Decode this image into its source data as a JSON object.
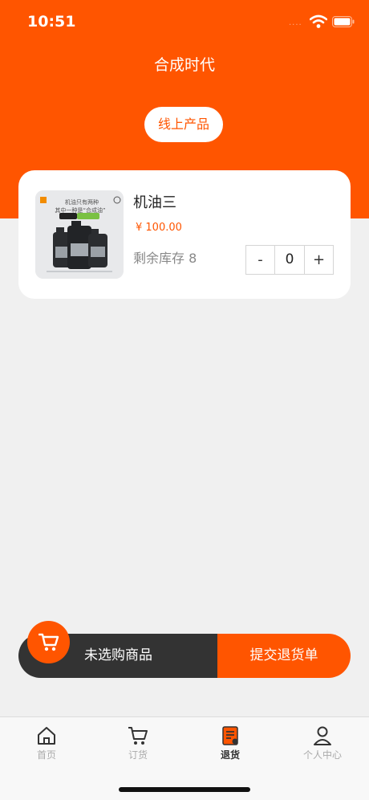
{
  "status_bar": {
    "time": "10:51",
    "signal_dots": "····"
  },
  "header": {
    "title": "合成时代",
    "segment_label": "线上产品"
  },
  "product": {
    "image_text_line1": "机油只有两种",
    "image_text_line2": "其中一种是“合成油”",
    "name": "机油三",
    "price": "¥ 100.00",
    "stock": "剩余库存 8",
    "quantity": "0",
    "minus_label": "-",
    "plus_label": "+"
  },
  "action_bar": {
    "summary": "未选购商品",
    "submit_label": "提交退货单"
  },
  "tabs": [
    {
      "label": "首页",
      "icon": "home-icon",
      "active": false
    },
    {
      "label": "订货",
      "icon": "cart-icon",
      "active": false
    },
    {
      "label": "退货",
      "icon": "return-doc-icon",
      "active": true
    },
    {
      "label": "个人中心",
      "icon": "person-icon",
      "active": false
    }
  ],
  "colors": {
    "accent": "#ff5500",
    "dark": "#333333",
    "background": "#f0f0f0"
  }
}
